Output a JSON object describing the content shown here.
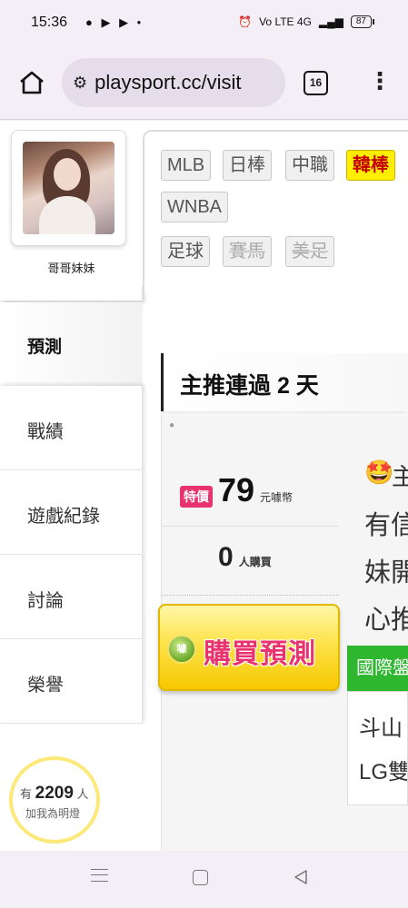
{
  "status_bar": {
    "time": "15:36",
    "notifications": "● ▶ ▶ •",
    "network": "Vo LTE 4G",
    "battery": "87"
  },
  "browser": {
    "url": "playsport.cc/visit",
    "tab_count": "16"
  },
  "profile": {
    "username": "哥哥妹妹"
  },
  "sidebar": {
    "active_item": "預測",
    "items": [
      "戰績",
      "遊戲紀錄",
      "討論",
      "榮譽"
    ]
  },
  "fans": {
    "prefix": "有",
    "count": "2209",
    "unit": "人",
    "cta": "加我為明燈"
  },
  "sport_tags": {
    "row1": [
      "MLB",
      "日棒",
      "中職",
      "韓棒"
    ],
    "row2": [
      "WNBA"
    ],
    "row3": [
      "足球",
      "賽馬",
      "美足"
    ],
    "highlighted": "韓棒"
  },
  "streak": {
    "title": "主推連過 2 天"
  },
  "prediction": {
    "special_label": "特價",
    "price": "79",
    "price_unit": "元噱幣",
    "buyers": "0",
    "buyers_unit": "人購買",
    "buy_button": "購買預測",
    "coin_label": "噱"
  },
  "article": {
    "emoji": "🤩",
    "first_char": "主",
    "lines": [
      "有信",
      "妹開",
      "心推"
    ]
  },
  "international": {
    "tag": "國際盤",
    "lines": [
      "斗山",
      "LG雙"
    ]
  },
  "colors": {
    "accent_pink": "#e8336f",
    "highlight_yellow": "#ffee00",
    "green_tag": "#2fb82f"
  }
}
